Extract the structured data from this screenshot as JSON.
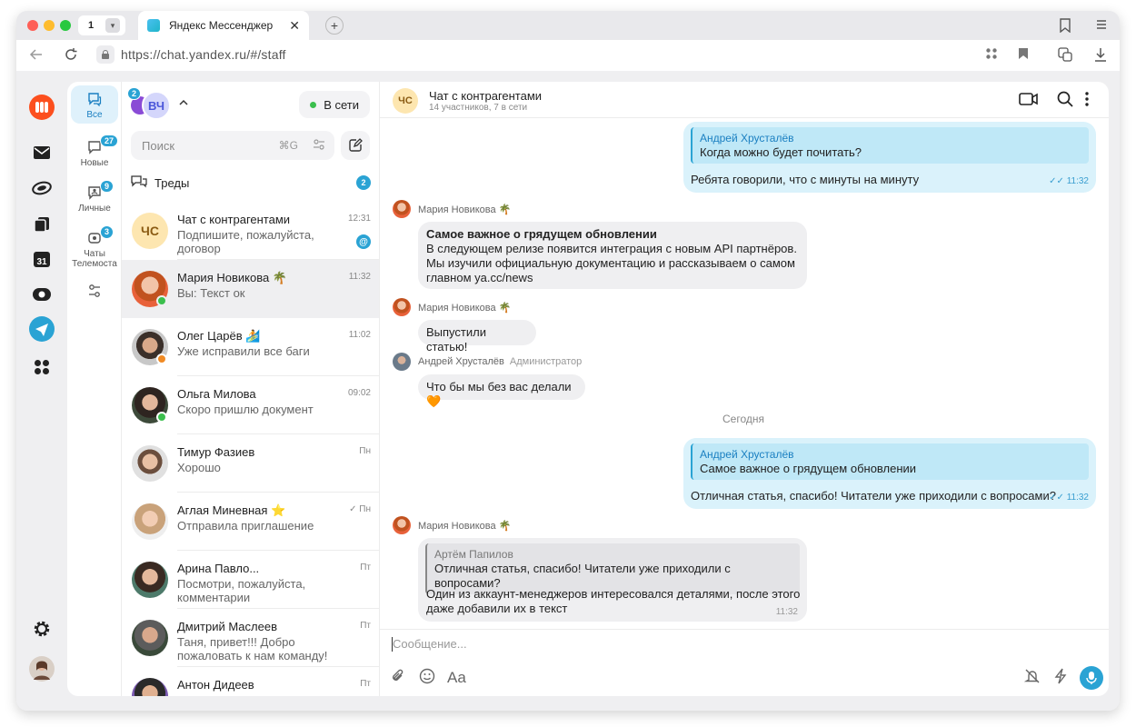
{
  "browser": {
    "tab_count": "1",
    "tab_title": "Яндекс Мессенджер",
    "url": "https://chat.yandex.ru/#/staff"
  },
  "filters": [
    {
      "label": "Все",
      "badge": ""
    },
    {
      "label": "Новые",
      "badge": "27"
    },
    {
      "label": "Личные",
      "badge": "9"
    },
    {
      "label": "Чаты Телемоста",
      "badge": "3"
    }
  ],
  "chatlist": {
    "account_initials": "ВЧ",
    "account_badge": "2",
    "online_label": "В сети",
    "search_placeholder": "Поиск",
    "search_shortcut": "⌘G",
    "threads_label": "Треды",
    "threads_badge": "2",
    "items": [
      {
        "name": "Чат с контрагентами",
        "preview": "Подпишите, пожалуйста, договор",
        "time": "12:31",
        "initials": "ЧС"
      },
      {
        "name": "Мария Новикова 🌴",
        "preview": "Вы: Текст ок",
        "time": "11:32"
      },
      {
        "name": "Олег Царёв 🏄",
        "preview": "Уже исправили все баги",
        "time": "11:02"
      },
      {
        "name": "Ольга Милова",
        "preview": "Скоро пришлю документ",
        "time": "09:02"
      },
      {
        "name": "Тимур Фазиев",
        "preview": "Хорошо",
        "time": "Пн"
      },
      {
        "name": "Аглая Миневная ⭐",
        "preview": "Отправила приглашение",
        "time": "✓ Пн"
      },
      {
        "name": "Арина Павло...",
        "preview": "Посмотри, пожалуйста, комментарии",
        "time": "Пт"
      },
      {
        "name": "Дмитрий Маслеев",
        "preview": "Таня, привет!!! Добро пожаловать к нам команду!",
        "time": "Пт"
      },
      {
        "name": "Антон Дидеев",
        "preview": "",
        "time": "Пт"
      }
    ]
  },
  "chat": {
    "header_initials": "ЧС",
    "title": "Чат с контрагентами",
    "subtitle": "14 участников, 7 в сети",
    "messages": {
      "m1_quote_name": "Андрей Хрусталёв",
      "m1_quote_text": "Когда можно будет почитать?",
      "m1_text": "Ребята говорили, что с минуты на минуту",
      "m1_time": "✓✓ 11:32",
      "s2_name": "Мария Новикова 🌴",
      "m2_title": "Самое важное о грядущем обновлении",
      "m2_line1": "В следующем релизе появится интеграция с новым API партнёров.",
      "m2_line2": "Мы изучили официальную документацию и рассказываем о самом",
      "m2_line3": "главном ya.cc/news",
      "s3_name": "Мария Новикова 🌴",
      "m3_text": "Выпустили статью!",
      "s4_name": "Андрей Хрусталёв",
      "s4_role": "Администратор",
      "m4_text": "Что бы мы без вас делали 🧡",
      "day_label": "Сегодня",
      "m5_quote_name": "Андрей Хрусталёв",
      "m5_quote_text": "Самое важное о грядущем обновлении",
      "m5_text": "Отличная статья, спасибо! Читатели уже приходили с вопросами?",
      "m5_time": "✓✓ 11:32",
      "s6_name": "Мария Новикова 🌴",
      "m6_quote_name": "Артём Папилов",
      "m6_quote_text": "Отличная статья, спасибо! Читатели уже приходили с вопросами?",
      "m6_line1": "Один из аккаунт-менеджеров интересовался деталями, после этого",
      "m6_line2": "даже добавили их в текст",
      "m6_time": "11:32"
    },
    "composer_placeholder": "Сообщение...",
    "format_label": "Aa"
  },
  "colors": {
    "accent": "#2aa3d4",
    "bubble_out": "#daf2fb",
    "bubble_in": "#efeff1",
    "online": "#3bbf4d",
    "away": "#f08a24"
  }
}
